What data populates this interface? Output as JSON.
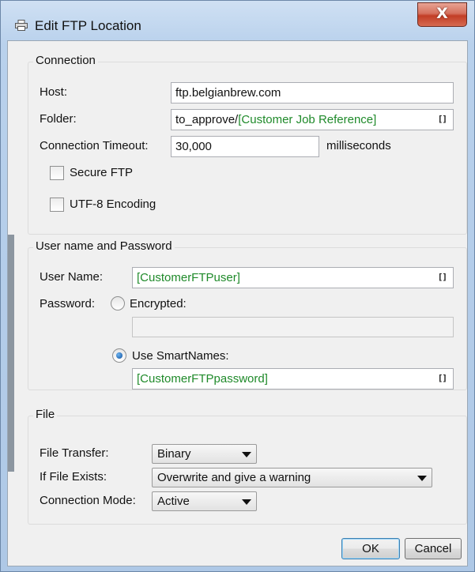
{
  "window": {
    "title": "Edit FTP Location",
    "close_label": "X"
  },
  "connection": {
    "group_title": "Connection",
    "host_label": "Host:",
    "host_value": "ftp.belgianbrew.com",
    "folder_label": "Folder:",
    "folder_static": "to_approve/",
    "folder_smartname": "[Customer Job Reference]",
    "timeout_label": "Connection Timeout:",
    "timeout_value": "30,000",
    "timeout_unit": "milliseconds",
    "secure_ftp_label": "Secure FTP",
    "secure_ftp_checked": false,
    "utf8_label": "UTF-8 Encoding",
    "utf8_checked": false
  },
  "credentials": {
    "group_title": "User name and Password",
    "username_label": "User Name:",
    "username_value": "[CustomerFTPuser]",
    "password_label": "Password:",
    "encrypted_label": "Encrypted:",
    "encrypted_selected": false,
    "encrypted_value": "",
    "smartnames_label": "Use SmartNames:",
    "smartnames_selected": true,
    "smartnames_value": "[CustomerFTPpassword]"
  },
  "file": {
    "group_title": "File",
    "transfer_label": "File Transfer:",
    "transfer_value": "Binary",
    "exists_label": "If File Exists:",
    "exists_value": "Overwrite and give a warning",
    "mode_label": "Connection Mode:",
    "mode_value": "Active"
  },
  "buttons": {
    "ok_label": "OK",
    "cancel_label": "Cancel"
  },
  "icons": {
    "title_icon": "printer-icon",
    "smartname_icon": "smartname-brackets-icon"
  },
  "colors": {
    "smartname_text": "#1f8a2a",
    "close_button": "#c94a31"
  }
}
